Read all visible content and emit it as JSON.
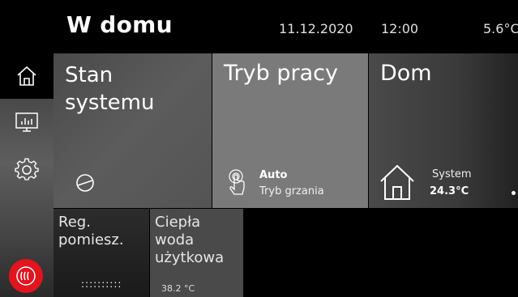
{
  "header": {
    "title": "W domu",
    "date": "11.12.2020",
    "time": "12:00",
    "outdoor_temp": "5.6°C"
  },
  "sidebar": {
    "items": [
      {
        "icon": "home-icon",
        "active": true
      },
      {
        "icon": "chart-icon",
        "active": false
      },
      {
        "icon": "gear-icon",
        "active": false
      }
    ],
    "logo": "heat-logo-icon"
  },
  "tiles": {
    "stan": {
      "title_line1": "Stan",
      "title_line2": "systemu",
      "icon": "compressor-icon"
    },
    "tryb": {
      "title": "Tryb pracy",
      "value": "Auto",
      "sub": "Tryb grzania",
      "icon": "touch-hand-icon"
    },
    "dom": {
      "title": "Dom",
      "label": "System",
      "temp": "24.3°C",
      "icon": "house-icon"
    },
    "reg": {
      "line1": "Reg.",
      "line2": "pomiesz.",
      "dots": "::::::::::"
    },
    "woda": {
      "line1": "Ciepła",
      "line2": "woda",
      "line3": "użytkowa",
      "temp": "38.2 °C"
    }
  },
  "colors": {
    "accent_red": "#e2141e",
    "tile_gray": "#7a7a7a",
    "background": "#000000"
  }
}
